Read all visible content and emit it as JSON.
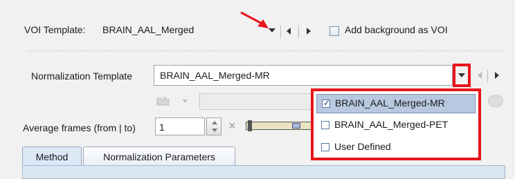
{
  "voi_template": {
    "label": "VOI Template:",
    "value": "BRAIN_AAL_Merged",
    "add_background_label": "Add background as VOI",
    "add_background_checked": false
  },
  "normalization": {
    "label": "Normalization Template",
    "value": "BRAIN_AAL_Merged-MR"
  },
  "dropdown_options": [
    {
      "label": "BRAIN_AAL_Merged-MR",
      "checked": true,
      "selected": true
    },
    {
      "label": "BRAIN_AAL_Merged-PET",
      "checked": false,
      "selected": false
    },
    {
      "label": "User Defined",
      "checked": false,
      "selected": false
    }
  ],
  "average_frames": {
    "label": "Average frames (from | to)",
    "from_value": "1"
  },
  "tabs": [
    {
      "label": "Method",
      "active": true
    },
    {
      "label": "Normalization Parameters",
      "active": false
    }
  ],
  "colors": {
    "highlight": "#e8141b",
    "selected_item": "#b7c8e0",
    "tab_body": "#d9e6f3"
  },
  "icons": [
    "red-arrow",
    "dropdown-arrow",
    "previous",
    "next",
    "folder",
    "clear",
    "spinner"
  ]
}
